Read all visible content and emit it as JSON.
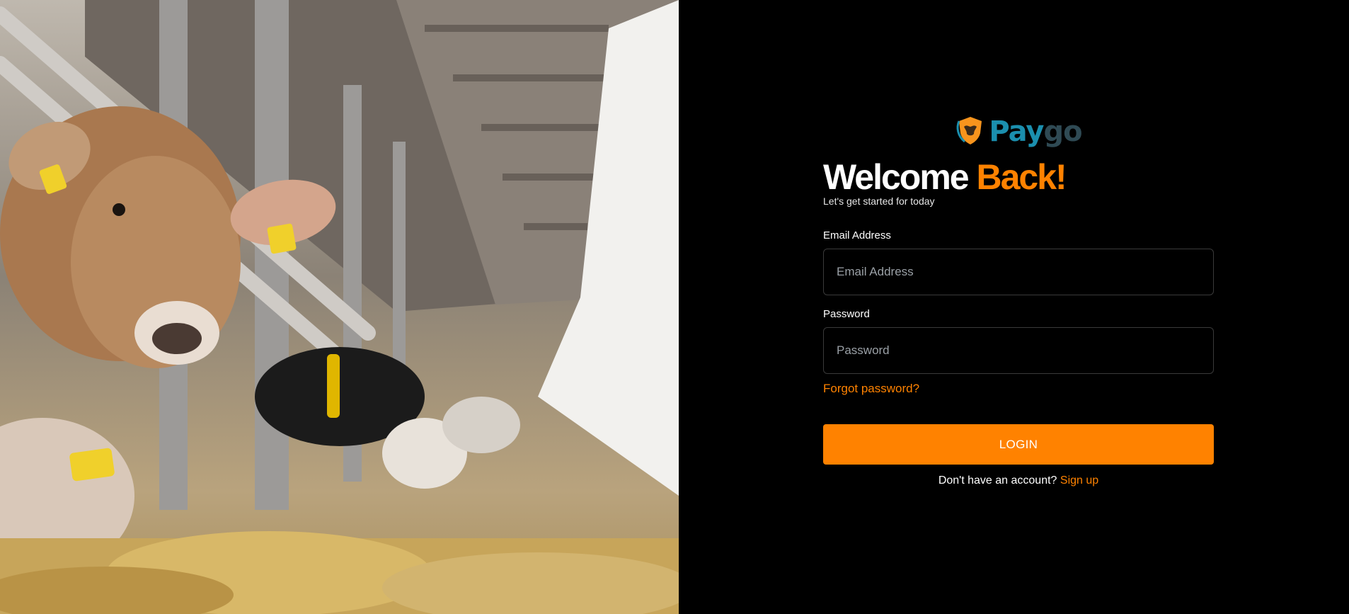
{
  "brand": {
    "name_part1": "Pay",
    "name_part2": "go",
    "logo_icon": "shield-bull-icon",
    "colors": {
      "accent": "#ff8200",
      "pay": "#1b8fae",
      "go": "#2f4a54",
      "shield": "#f7941d"
    }
  },
  "hero_image": {
    "description_icon": "cows-feeding-photo"
  },
  "login": {
    "title_main": "Welcome ",
    "title_accent": "Back!",
    "subtitle": "Let's get started for today",
    "email": {
      "label": "Email Address",
      "placeholder": "Email Address",
      "value": ""
    },
    "password": {
      "label": "Password",
      "placeholder": "Password",
      "value": ""
    },
    "forgot_label": "Forgot password?",
    "submit_label": "LOGIN",
    "signup_prompt": "Don't have an account? ",
    "signup_label": "Sign up"
  }
}
